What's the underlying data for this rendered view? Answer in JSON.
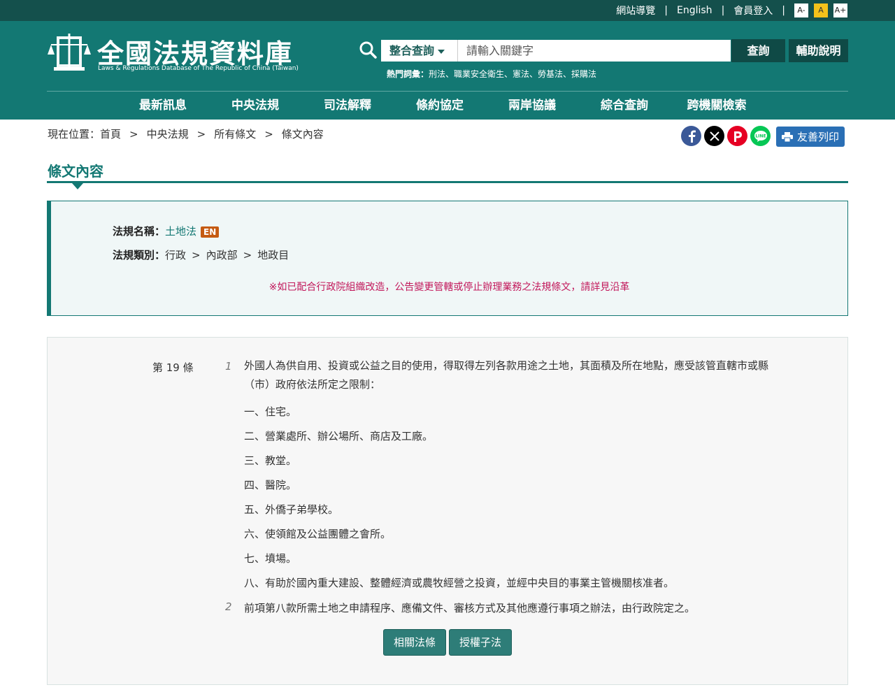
{
  "topbar": {
    "sitemap": "網站導覽",
    "english": "English",
    "login": "會員登入",
    "font_small": "A-",
    "font_medium": "A",
    "font_large": "A+"
  },
  "header": {
    "logo_title": "全國法規資料庫",
    "logo_subtitle": "Laws & Regulations Database of The Republic of China (Taiwan)",
    "search_scope": "整合查詢",
    "search_placeholder": "請輸入關鍵字",
    "search_button": "查詢",
    "help_button": "輔助說明",
    "hot_label": "熱門詞彙：",
    "hot_terms": "刑法、職業安全衛生、憲法、勞基法、採購法"
  },
  "nav": [
    "最新訊息",
    "中央法規",
    "司法解釋",
    "條約協定",
    "兩岸協議",
    "綜合查詢",
    "跨機關檢索"
  ],
  "breadcrumb": {
    "prefix": "現在位置：",
    "items": [
      "首頁",
      "中央法規",
      "所有條文",
      "條文內容"
    ],
    "separator": ">"
  },
  "share": {
    "icons": [
      "facebook-icon",
      "x-icon",
      "plurk-icon",
      "line-icon"
    ],
    "print": "友善列印"
  },
  "page_title": "條文內容",
  "law": {
    "name_label": "法規名稱：",
    "name": "土地法",
    "en_badge": "EN",
    "category_label": "法規類別：",
    "category": [
      "行政",
      "內政部",
      "地政目"
    ],
    "notice": "※如已配合行政院組織改造，公告變更管轄或停止辦理業務之法規條文，請詳見沿革"
  },
  "article": {
    "number": "第 19 條",
    "paragraphs": [
      {
        "no": "1",
        "text": "外國人為供自用、投資或公益之目的使用，得取得左列各款用途之土地，其面積及所在地點，應受該管直轄市或縣（市）政府依法所定之限制："
      },
      {
        "no": "2",
        "text": "前項第八款所需土地之申請程序、應備文件、審核方式及其他應遵行事項之辦法，由行政院定之。"
      }
    ],
    "items": [
      "一、住宅。",
      "二、營業處所、辦公場所、商店及工廠。",
      "三、教堂。",
      "四、醫院。",
      "五、外僑子弟學校。",
      "六、使領館及公益團體之會所。",
      "七、墳場。",
      "八、有助於國內重大建設、整體經濟或農牧經營之投資，並經中央目的事業主管機關核准者。"
    ],
    "buttons": [
      "相關法條",
      "授權子法"
    ]
  },
  "colors": {
    "topbar": "#14504c",
    "header": "#137873",
    "accent": "#137873",
    "notice": "#c2185b",
    "print": "#2a6fb5"
  }
}
